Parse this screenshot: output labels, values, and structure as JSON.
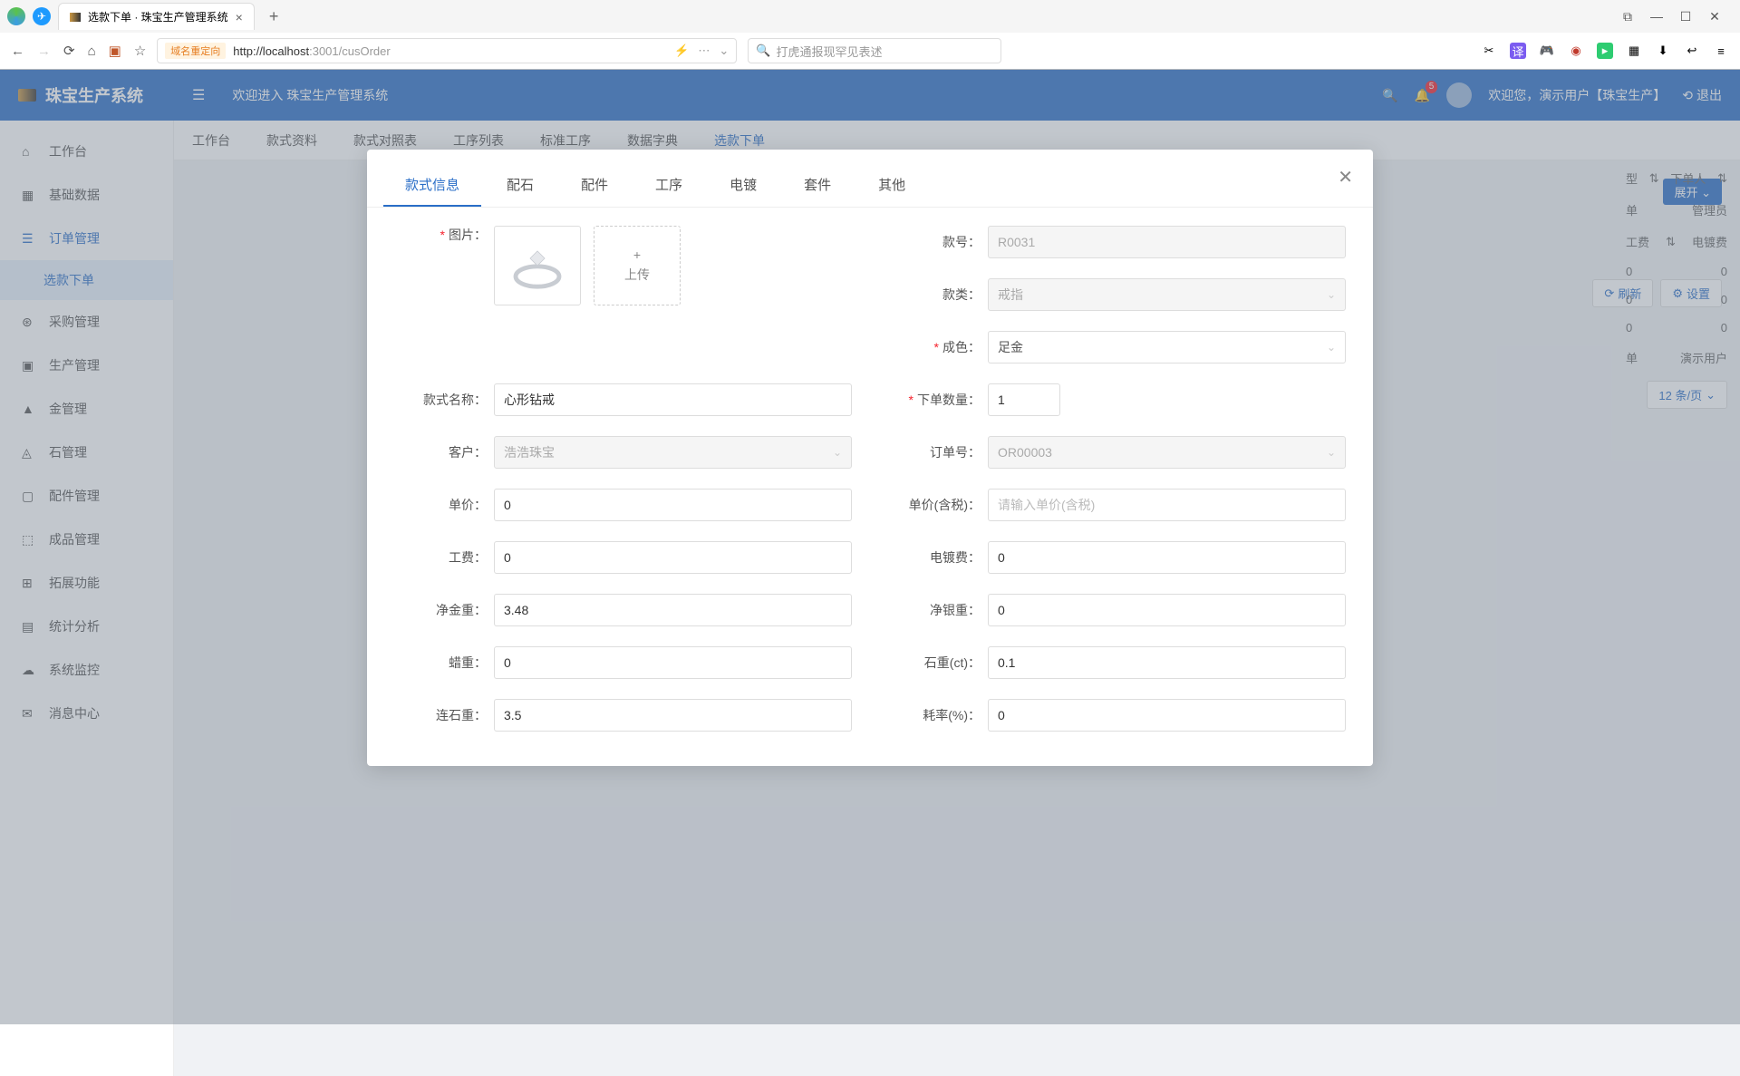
{
  "browser": {
    "tab_title": "选款下单 · 珠宝生产管理系统",
    "url_redirect": "域名重定向",
    "url_host": "http://localhost",
    "url_port_path": ":3001/cusOrder",
    "search_placeholder": "打虎通报现罕见表述"
  },
  "app": {
    "name": "珠宝生产系统",
    "welcome": "欢迎进入 珠宝生产管理系统",
    "user_welcome": "欢迎您，演示用户【珠宝生产】",
    "logout": "退出",
    "notification_count": "5"
  },
  "sidebar": {
    "items": [
      {
        "icon": "⌂",
        "label": "工作台"
      },
      {
        "icon": "▦",
        "label": "基础数据"
      },
      {
        "icon": "☰",
        "label": "订单管理"
      },
      {
        "icon": "",
        "label": "选款下单",
        "sub": true
      },
      {
        "icon": "⊛",
        "label": "采购管理"
      },
      {
        "icon": "▣",
        "label": "生产管理"
      },
      {
        "icon": "▲",
        "label": "金管理"
      },
      {
        "icon": "◬",
        "label": "石管理"
      },
      {
        "icon": "▢",
        "label": "配件管理"
      },
      {
        "icon": "⬚",
        "label": "成品管理"
      },
      {
        "icon": "⊞",
        "label": "拓展功能"
      },
      {
        "icon": "▤",
        "label": "统计分析"
      },
      {
        "icon": "☁",
        "label": "系统监控"
      },
      {
        "icon": "✉",
        "label": "消息中心"
      }
    ]
  },
  "top_tabs": [
    "工作台",
    "款式资料",
    "款式对照表",
    "工序列表",
    "标准工序",
    "数据字典",
    "选款下单"
  ],
  "toolbar": {
    "expand": "展开",
    "refresh": "刷新",
    "settings": "设置"
  },
  "bg": {
    "h1": "下单人",
    "c1": "管理员",
    "h2": "电镀费",
    "c2a": "0",
    "c2b": "0",
    "c2c": "0",
    "c3": "演示用户",
    "pager": "12 条/页",
    "hdr": "型",
    "fee": "工费",
    "dan": "单"
  },
  "modal": {
    "tabs": [
      "款式信息",
      "配石",
      "配件",
      "工序",
      "电镀",
      "套件",
      "其他"
    ],
    "labels": {
      "pic": "图片：",
      "code": "款号：",
      "type": "款类：",
      "color": "成色：",
      "name": "款式名称：",
      "qty": "下单数量：",
      "cust": "客户：",
      "orderno": "订单号：",
      "price": "单价：",
      "pricetax": "单价(含税)：",
      "fee": "工费：",
      "plate": "电镀费：",
      "netgold": "净金重：",
      "netsilver": "净银重：",
      "wax": "蜡重：",
      "stone": "石重(ct)：",
      "withstone": "连石重：",
      "loss": "耗率(%)：",
      "upload": "上传"
    },
    "values": {
      "code": "R0031",
      "type": "戒指",
      "color": "足金",
      "name": "心形钻戒",
      "qty": "1",
      "cust": "浩浩珠宝",
      "orderno": "OR00003",
      "price": "0",
      "pricetax_ph": "请输入单价(含税)",
      "fee": "0",
      "plate": "0",
      "netgold": "3.48",
      "netsilver": "0",
      "wax": "0",
      "stone": "0.1",
      "withstone": "3.5",
      "loss": "0"
    }
  }
}
